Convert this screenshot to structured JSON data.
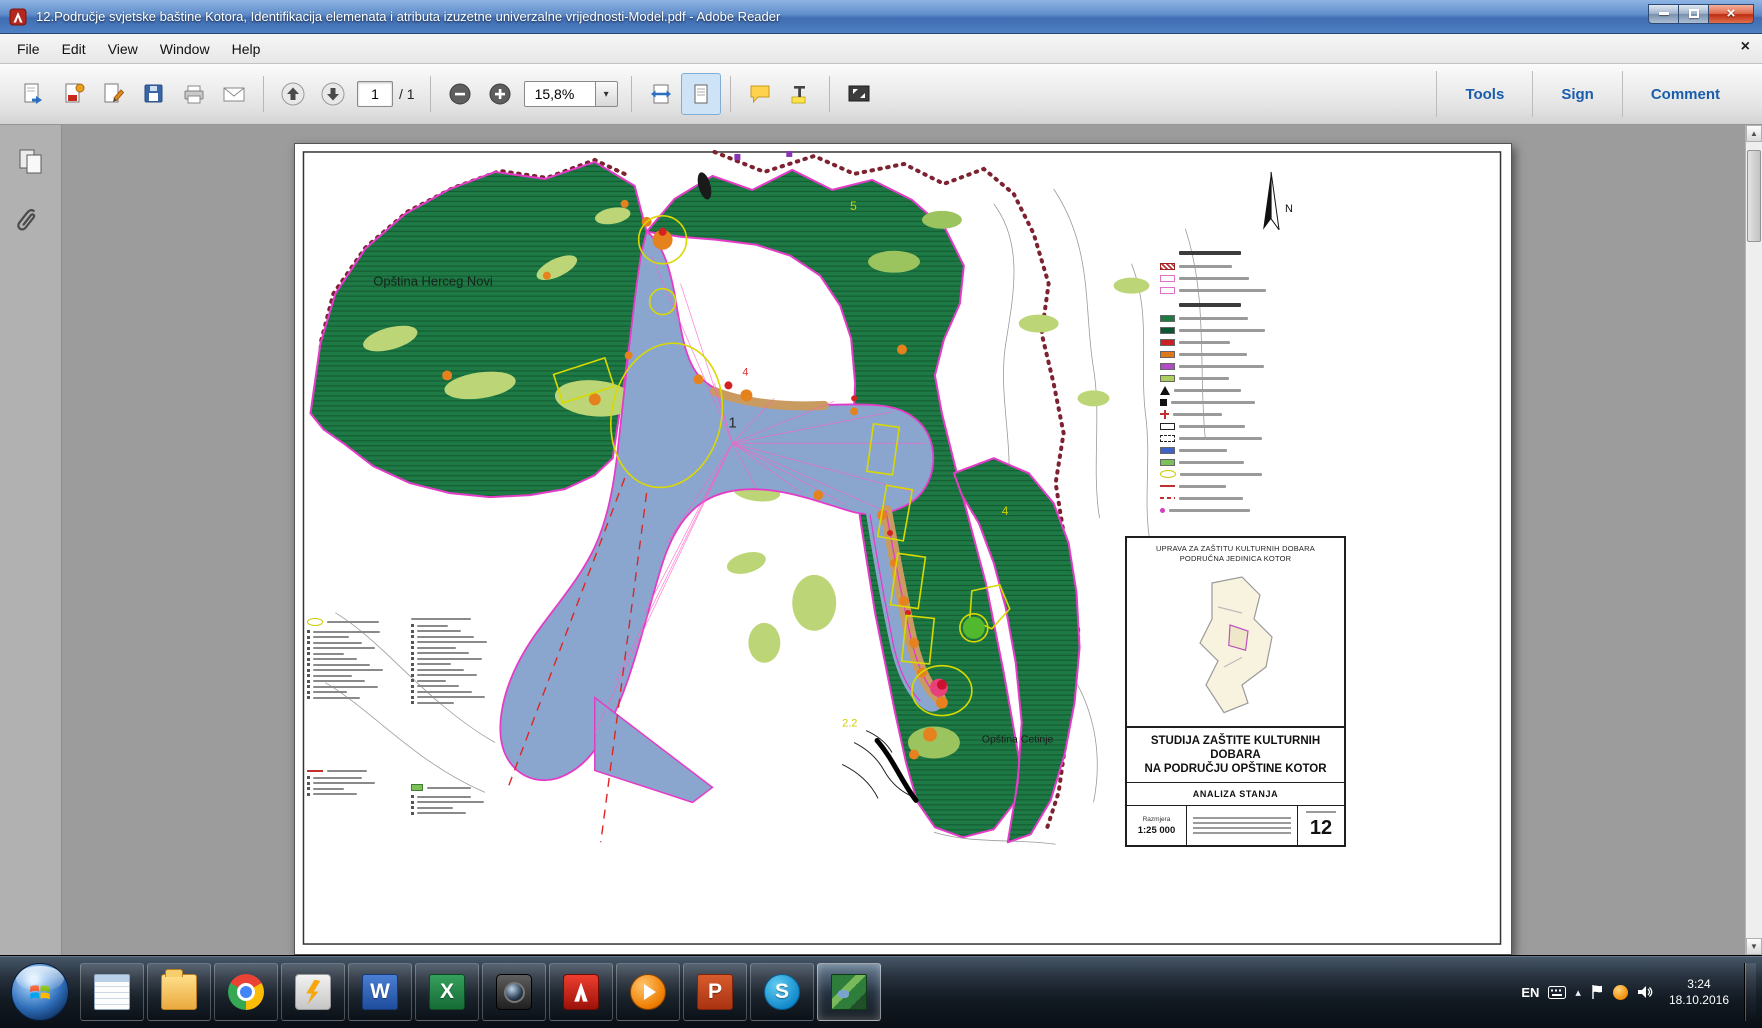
{
  "window": {
    "title": "12.Područje svjetske baštine Kotora, Identifikacija elemenata i atributa izuzetne univerzalne vrijednosti-Model.pdf - Adobe Reader"
  },
  "icons": {
    "close_glyph": "×",
    "menubar_close_glyph": "×",
    "caret_down": "▾",
    "tray_expand": "▴",
    "scroll_up": "▲",
    "scroll_down": "▼"
  },
  "menu": {
    "items": [
      {
        "label": "File"
      },
      {
        "label": "Edit"
      },
      {
        "label": "View"
      },
      {
        "label": "Window"
      },
      {
        "label": "Help"
      }
    ]
  },
  "toolbar": {
    "page_current": "1",
    "page_total": "/ 1",
    "zoom_level": "15,8%",
    "tools": "Tools",
    "sign": "Sign",
    "comment": "Comment"
  },
  "map": {
    "labels": {
      "herceg_novi": "Opština Herceg Novi",
      "cetinje": "Opština Cetinje",
      "north": "N",
      "zone_1": "1",
      "zone_4_yellow": "4",
      "zone_5_yellow": "5",
      "zone_2_2": "2.2",
      "zone_4_red": "4"
    },
    "colors": {
      "municipality_green": "#1e7a44",
      "bay_blue": "#8ba6ce",
      "boundary_magenta": "#e43cc8",
      "vegetation_light_green": "#bcd677",
      "settlement_orange": "#e5821e",
      "protection_yellow": "#d9d900"
    },
    "legend": {
      "rows": [
        {
          "kind": "hdr",
          "header": true
        },
        {
          "kind": "hatch"
        },
        {
          "kind": "outline-pink"
        },
        {
          "kind": "outline-pink"
        },
        {
          "kind": "hdr",
          "header": true
        },
        {
          "kind": "fill",
          "color": "#1e7a44"
        },
        {
          "kind": "fill",
          "color": "#0d5530"
        },
        {
          "kind": "fill",
          "color": "#cc1f1f"
        },
        {
          "kind": "fill",
          "color": "#e07818"
        },
        {
          "kind": "fill",
          "color": "#b14cc4"
        },
        {
          "kind": "fill",
          "color": "#a9d05e"
        },
        {
          "kind": "tri"
        },
        {
          "kind": "sq"
        },
        {
          "kind": "cross"
        },
        {
          "kind": "outline-black"
        },
        {
          "kind": "dash-outline"
        },
        {
          "kind": "fill",
          "color": "#3f62c9"
        },
        {
          "kind": "fill",
          "color": "#7cc05a"
        },
        {
          "kind": "ellipse"
        },
        {
          "kind": "line-red"
        },
        {
          "kind": "line-dash"
        },
        {
          "kind": "dot"
        }
      ]
    },
    "title_block": {
      "org_line1": "UPRAVA ZA ZAŠTITU KULTURNIH DOBARA",
      "org_line2": "PODRUČNA JEDINICA KOTOR",
      "title_line1": "STUDIJA ZAŠTITE KULTURNIH DOBARA",
      "title_line2": "NA PODRUČJU OPŠTINE KOTOR",
      "subtitle": "ANALIZA STANJA",
      "scale_label": "Razmjera",
      "scale_value": "1:25 000",
      "sheet_number": "12"
    }
  },
  "taskbar": {
    "apps": [
      {
        "name": "notepad",
        "kind": "notepad",
        "glyph": ""
      },
      {
        "name": "folder",
        "kind": "folder",
        "glyph": ""
      },
      {
        "name": "chrome",
        "kind": "chrome",
        "glyph": ""
      },
      {
        "name": "winamp",
        "kind": "winamp",
        "glyph": ""
      },
      {
        "name": "word",
        "kind": "word",
        "glyph": "W"
      },
      {
        "name": "excel",
        "kind": "excel",
        "glyph": "X"
      },
      {
        "name": "camera",
        "kind": "camera",
        "glyph": ""
      },
      {
        "name": "adobe-reader",
        "kind": "adobe",
        "glyph": ""
      },
      {
        "name": "media-player",
        "kind": "media",
        "glyph": ""
      },
      {
        "name": "powerpoint",
        "kind": "powerpoint",
        "glyph": "P"
      },
      {
        "name": "skype",
        "kind": "skype",
        "glyph": "S"
      },
      {
        "name": "image-viewer",
        "kind": "viewer",
        "glyph": "",
        "active": true
      }
    ],
    "tray": {
      "lang": "EN",
      "time": "3:24",
      "date": "18.10.2016"
    }
  }
}
